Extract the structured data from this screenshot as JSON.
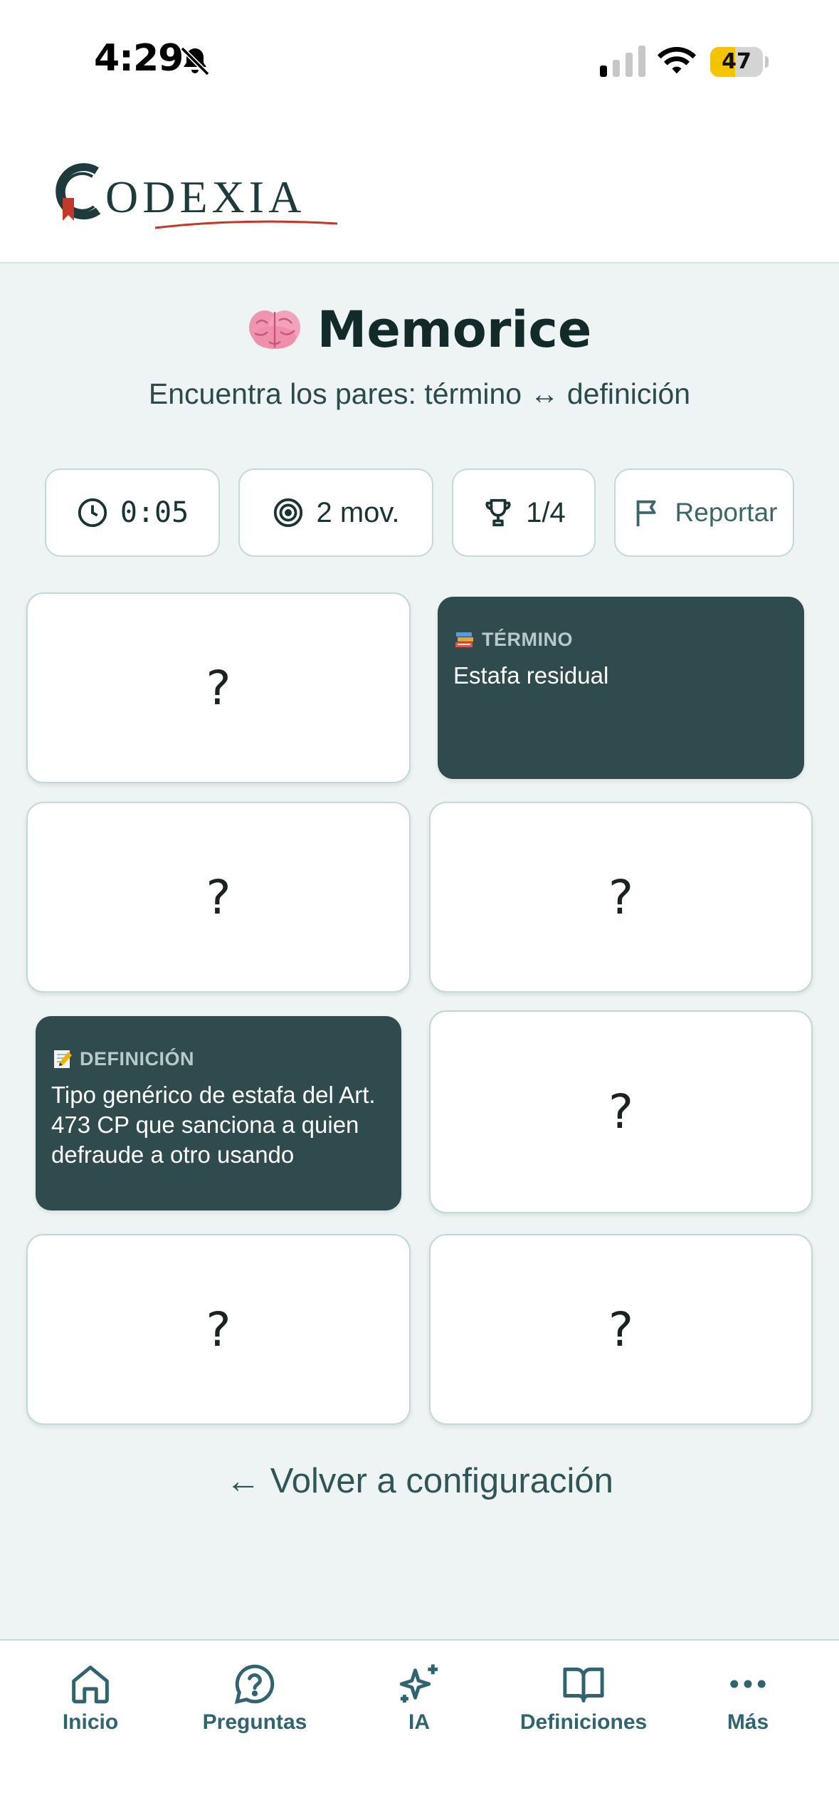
{
  "status_bar": {
    "time": "4:29",
    "battery": "47",
    "battery_level": 0.47,
    "battery_color": "#f5c400"
  },
  "header": {
    "logo_text": "ODEXIA",
    "brand_color": "#1f3a3c",
    "accent_color": "#c0392b"
  },
  "game": {
    "title": "Memorice",
    "subtitle": "Encuentra los pares: término ↔ definición"
  },
  "stats": {
    "time_icon": "clock-icon",
    "time": "0:05",
    "moves_icon": "target-icon",
    "moves": "2 mov.",
    "pairs_icon": "trophy-icon",
    "pairs": "1/4",
    "report_icon": "flag-icon",
    "report_label": "Reportar"
  },
  "cards": [
    {
      "state": "hidden",
      "label": "?"
    },
    {
      "state": "revealed",
      "kind": "TÉRMINO",
      "icon": "books-icon",
      "text": "Estafa residual"
    },
    {
      "state": "hidden",
      "label": "?"
    },
    {
      "state": "hidden",
      "label": "?"
    },
    {
      "state": "revealed",
      "kind": "DEFINICIÓN",
      "icon": "memo-icon",
      "text": "Tipo genérico de estafa del Art. 473 CP que sanciona a quien defraude a otro usando cualquier otro"
    },
    {
      "state": "hidden",
      "label": "?"
    },
    {
      "state": "hidden",
      "label": "?"
    },
    {
      "state": "hidden",
      "label": "?"
    }
  ],
  "back_link": "← Volver a configuración",
  "bottom_nav": [
    {
      "label": "Inicio",
      "icon": "home-icon"
    },
    {
      "label": "Preguntas",
      "icon": "question-icon"
    },
    {
      "label": "IA",
      "icon": "sparkles-icon"
    },
    {
      "label": "Definiciones",
      "icon": "book-icon"
    },
    {
      "label": "Más",
      "icon": "more-icon"
    }
  ]
}
